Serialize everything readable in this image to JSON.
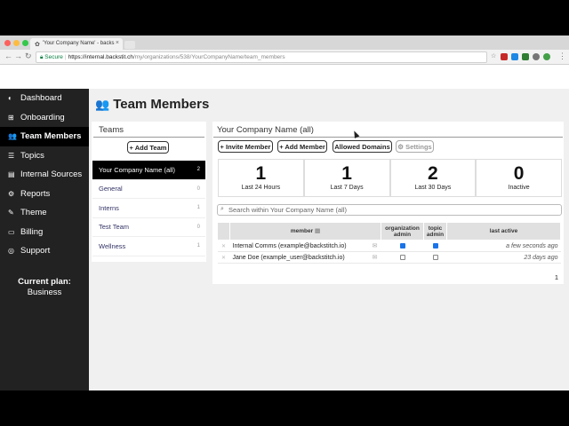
{
  "browser": {
    "tab_title": "'Your Company Name' - backs",
    "secure_label": "Secure",
    "url_host": "https://internal.backstit.ch",
    "url_path": "/my/organizations/538/YourCompanyName/team_members"
  },
  "sidebar": {
    "items": [
      {
        "label": "Dashboard",
        "icon": "dashboard-icon",
        "glyph": "◐"
      },
      {
        "label": "Onboarding",
        "icon": "onboarding-icon",
        "glyph": "⊞"
      },
      {
        "label": "Team Members",
        "icon": "team-icon",
        "glyph": "👥"
      },
      {
        "label": "Topics",
        "icon": "topics-icon",
        "glyph": "☰"
      },
      {
        "label": "Internal Sources",
        "icon": "sources-icon",
        "glyph": "▤"
      },
      {
        "label": "Reports",
        "icon": "reports-icon",
        "glyph": "⚙"
      },
      {
        "label": "Theme",
        "icon": "theme-icon",
        "glyph": "✎"
      },
      {
        "label": "Billing",
        "icon": "billing-icon",
        "glyph": "▭"
      },
      {
        "label": "Support",
        "icon": "support-icon",
        "glyph": "◎"
      }
    ],
    "plan_label": "Current plan:",
    "plan_value": "Business"
  },
  "page": {
    "title": "Team Members"
  },
  "teams": {
    "header": "Teams",
    "add_team": "+ Add Team",
    "items": [
      {
        "name": "Your Company Name (all)",
        "count": "2"
      },
      {
        "name": "General",
        "count": "0"
      },
      {
        "name": "Interns",
        "count": "1"
      },
      {
        "name": "Test Team",
        "count": "0"
      },
      {
        "name": "Wellness",
        "count": "1"
      }
    ]
  },
  "content": {
    "header": "Your Company Name (all)",
    "buttons": {
      "invite": "+ Invite Member",
      "add": "+ Add Member",
      "domains": "Allowed Domains",
      "settings": "⚙ Settings"
    },
    "stats": [
      {
        "value": "1",
        "label": "Last 24 Hours"
      },
      {
        "value": "1",
        "label": "Last 7 Days"
      },
      {
        "value": "2",
        "label": "Last 30 Days"
      },
      {
        "value": "0",
        "label": "Inactive"
      }
    ],
    "search_placeholder": "Search within Your Company Name (all)",
    "columns": {
      "member": "member",
      "org_admin_1": "organization",
      "org_admin_2": "admin",
      "topic_admin_1": "topic",
      "topic_admin_2": "admin",
      "last_active": "last active"
    },
    "rows": [
      {
        "member": "Internal Comms (example@backstitch.io)",
        "org_admin": true,
        "topic_admin": true,
        "last_active": "a few seconds ago"
      },
      {
        "member": "Jane Doe (example_user@backstitch.io)",
        "org_admin": false,
        "topic_admin": false,
        "last_active": "23 days ago"
      }
    ],
    "page_number": "1"
  }
}
